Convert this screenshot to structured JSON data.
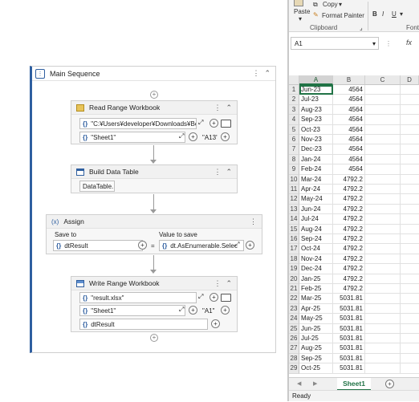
{
  "workflow": {
    "sequence_title": "Main Sequence",
    "read_range": {
      "title": "Read Range Workbook",
      "path_value": "\"C:¥Users¥developer¥Downloads¥Bool",
      "sheet_value": "\"Sheet1\"",
      "range_value": "\"A13\""
    },
    "build_table": {
      "title": "Build Data Table",
      "button_label": "DataTable..."
    },
    "assign": {
      "title": "Assign",
      "save_to_label": "Save to",
      "value_label": "Value to save",
      "save_to_value": "dtResult",
      "equals": "=",
      "value_expr": "dt.AsEnumerable.Selec"
    },
    "write_range": {
      "title": "Write Range Workbook",
      "file_value": "\"result.xlsx\"",
      "sheet_value": "\"Sheet1\"",
      "range_value": "\"A1\"",
      "data_value": "dtResult"
    }
  },
  "excel": {
    "clipboard": {
      "paste": "Paste",
      "copy": "Copy",
      "format_painter": "Format Painter",
      "group_label": "Clipboard"
    },
    "font_group_label": "Font",
    "font_buttons": [
      "B",
      "I",
      "U"
    ],
    "name_box": "A1",
    "formula_fx": "fx",
    "columns": [
      "A",
      "B",
      "C",
      "D"
    ],
    "rows": [
      {
        "n": "1",
        "a": "Jun-23",
        "b": "4564"
      },
      {
        "n": "2",
        "a": "Jul-23",
        "b": "4564"
      },
      {
        "n": "3",
        "a": "Aug-23",
        "b": "4564"
      },
      {
        "n": "4",
        "a": "Sep-23",
        "b": "4564"
      },
      {
        "n": "5",
        "a": "Oct-23",
        "b": "4564"
      },
      {
        "n": "6",
        "a": "Nov-23",
        "b": "4564"
      },
      {
        "n": "7",
        "a": "Dec-23",
        "b": "4564"
      },
      {
        "n": "8",
        "a": "Jan-24",
        "b": "4564"
      },
      {
        "n": "9",
        "a": "Feb-24",
        "b": "4564"
      },
      {
        "n": "10",
        "a": "Mar-24",
        "b": "4792.2"
      },
      {
        "n": "11",
        "a": "Apr-24",
        "b": "4792.2"
      },
      {
        "n": "12",
        "a": "May-24",
        "b": "4792.2"
      },
      {
        "n": "13",
        "a": "Jun-24",
        "b": "4792.2"
      },
      {
        "n": "14",
        "a": "Jul-24",
        "b": "4792.2"
      },
      {
        "n": "15",
        "a": "Aug-24",
        "b": "4792.2"
      },
      {
        "n": "16",
        "a": "Sep-24",
        "b": "4792.2"
      },
      {
        "n": "17",
        "a": "Oct-24",
        "b": "4792.2"
      },
      {
        "n": "18",
        "a": "Nov-24",
        "b": "4792.2"
      },
      {
        "n": "19",
        "a": "Dec-24",
        "b": "4792.2"
      },
      {
        "n": "20",
        "a": "Jan-25",
        "b": "4792.2"
      },
      {
        "n": "21",
        "a": "Feb-25",
        "b": "4792.2"
      },
      {
        "n": "22",
        "a": "Mar-25",
        "b": "5031.81"
      },
      {
        "n": "23",
        "a": "Apr-25",
        "b": "5031.81"
      },
      {
        "n": "24",
        "a": "May-25",
        "b": "5031.81"
      },
      {
        "n": "25",
        "a": "Jun-25",
        "b": "5031.81"
      },
      {
        "n": "26",
        "a": "Jul-25",
        "b": "5031.81"
      },
      {
        "n": "27",
        "a": "Aug-25",
        "b": "5031.81"
      },
      {
        "n": "28",
        "a": "Sep-25",
        "b": "5031.81"
      },
      {
        "n": "29",
        "a": "Oct-25",
        "b": "5031.81"
      }
    ],
    "sheet_tab": "Sheet1",
    "status": "Ready",
    "accent": "#217346"
  }
}
